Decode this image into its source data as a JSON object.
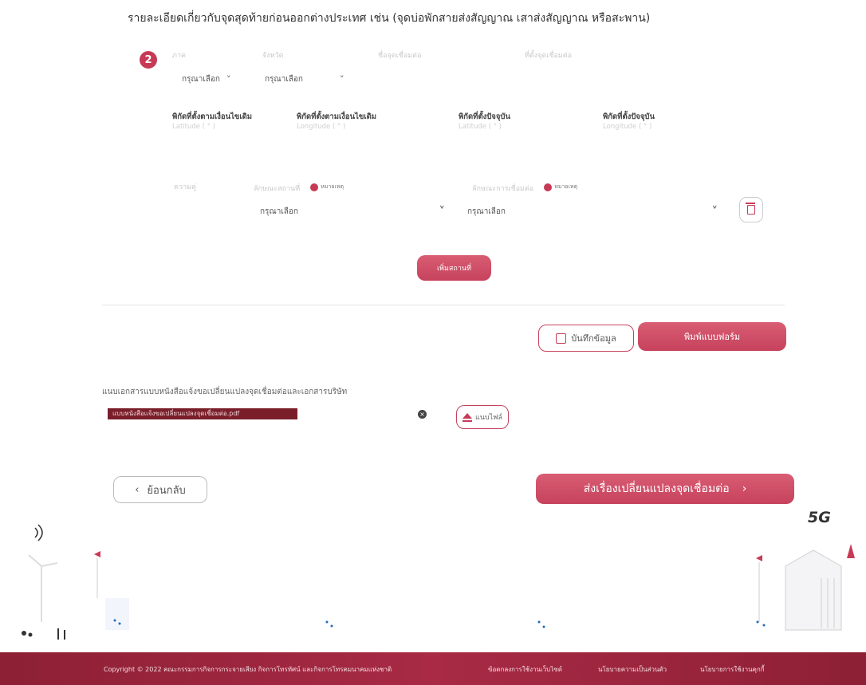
{
  "page_title": "รายละเอียดเกี่ยวกับจุดสุดท้ายก่อนออกต่างประเทศ เช่น (จุดบ่อพักสายส่งสัญญาณ เสาส่งสัญญาณ หรือสะพาน)",
  "step_number": "2",
  "faint_headers": [
    "ภาค",
    "จังหวัด",
    "ชื่อจุดเชื่อมต่อ",
    "ที่ตั้งจุดเชื่อมต่อ"
  ],
  "selects_row1": {
    "region": "กรุณาเลือก",
    "province": "กรุณาเลือก"
  },
  "coords": [
    {
      "label": "พิกัดที่ตั้งตามเงื่อนไขเดิม",
      "sub": "Latitude ( ° )"
    },
    {
      "label": "พิกัดที่ตั้งตามเงื่อนไขเดิม",
      "sub": "Longitude ( ° )"
    },
    {
      "label": "พิกัดที่ตั้งปัจจุบัน",
      "sub": "Latitude ( ° )"
    },
    {
      "label": "พิกัดที่ตั้งปัจจุบัน",
      "sub": "Longitude ( ° )"
    }
  ],
  "change_row": {
    "first_label": "ความคู่",
    "field1_label": "ลักษณะสถานที่",
    "field2_label": "ลักษณะการเชื่อมต่อ",
    "required_text": "หมายเหตุ",
    "field1_value": "กรุณาเลือก",
    "field2_value": "กรุณาเลือก"
  },
  "add_place_label": "เพิ่มสถานที่",
  "save_label": "บันทึกข้อมูล",
  "print_label": "พิมพ์แบบฟอร์ม",
  "doc_label": "แนบเอกสารแบบหนังสือแจ้งขอเปลี่ยนแปลงจุดเชื่อมต่อและเอกสารบริษัท",
  "file_name": "แบบหนังสือแจ้งขอเปลี่ยนแปลงจุดเชื่อมต่อ.pdf",
  "upload_label": "แนบไฟล์",
  "back_label": "ย้อนกลับ",
  "submit_label": "ส่งเรื่องเปลี่ยนแปลงจุดเชื่อมต่อ",
  "deco_5g": "5G",
  "footer": {
    "copyright": "Copyright © 2022 คณะกรรมการกิจการกระจายเสียง กิจการโทรทัศน์ และกิจการโทรคมนาคมแห่งชาติ",
    "links": [
      "ข้อตกลงการใช้งานเว็บไซต์",
      "นโยบายความเป็นส่วนตัว",
      "นโยบายการใช้งานคุกกี้"
    ]
  },
  "colors": {
    "accent": "#c73a56",
    "footer": "#9b2640"
  }
}
